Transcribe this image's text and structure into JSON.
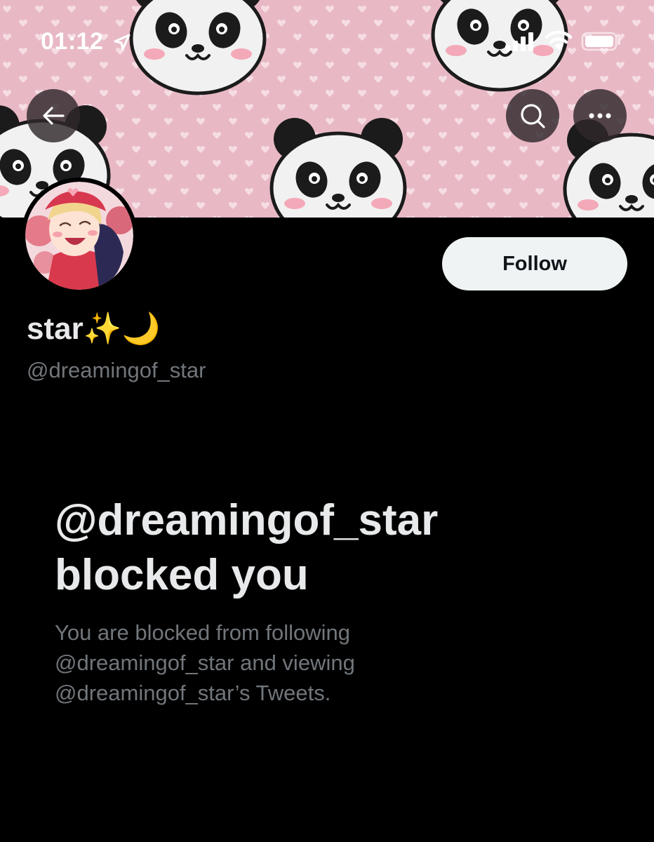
{
  "status_bar": {
    "time": "01:12"
  },
  "header": {
    "back_icon": "arrow-left-icon",
    "search_icon": "search-icon",
    "more_icon": "more-horizontal-icon"
  },
  "profile": {
    "display_name": "star✨🌙",
    "handle": "@dreamingof_star",
    "follow_label": "Follow"
  },
  "blocked_notice": {
    "title_line1": "@dreamingof_star",
    "title_line2": "blocked you",
    "desc_line1": "You are blocked from following",
    "desc_line2": "@dreamingof_star and viewing",
    "desc_line3": "@dreamingof_star’s Tweets."
  },
  "colors": {
    "background": "#000000",
    "banner_pink": "#e8b9c5",
    "primary_text": "#e7e9ea",
    "secondary_text": "#71767b",
    "follow_bg": "#eff3f4"
  }
}
